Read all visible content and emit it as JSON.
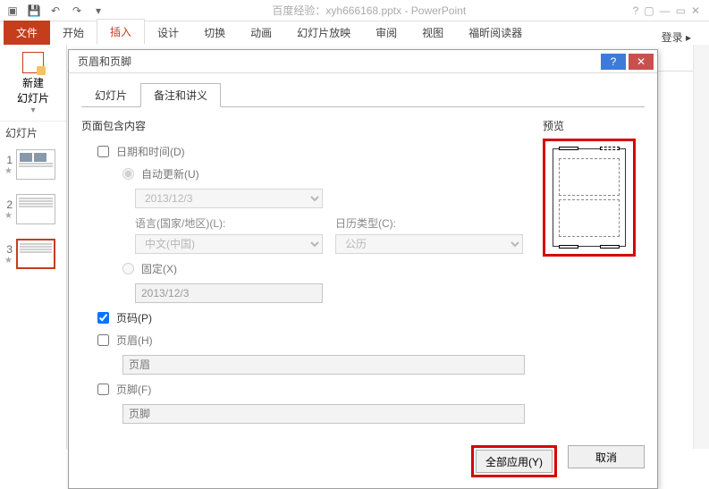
{
  "titlebar": {
    "doc": "百度经验：xyh666168.pptx - PowerPoint"
  },
  "ribbon": {
    "file": "文件",
    "tabs": [
      "开始",
      "插入",
      "设计",
      "切换",
      "动画",
      "幻灯片放映",
      "审阅",
      "视图",
      "福昕阅读器"
    ],
    "active_index": 1,
    "login": "登录"
  },
  "leftpanel": {
    "newslide": "新建\n幻灯片",
    "heading": "幻灯片",
    "thumbs": [
      1,
      2,
      3
    ],
    "selected": 3
  },
  "dialog": {
    "title": "页眉和页脚",
    "tabs": {
      "slide": "幻灯片",
      "notes": "备注和讲义",
      "active": 1
    },
    "section": "页面包含内容",
    "datetime": {
      "chk_label": "日期和时间(D)",
      "checked": false,
      "auto": {
        "label": "自动更新(U)",
        "value": "2013/12/3",
        "lang_label": "语言(国家/地区)(L):",
        "lang_value": "中文(中国)",
        "cal_label": "日历类型(C):",
        "cal_value": "公历"
      },
      "fixed": {
        "label": "固定(X)",
        "value": "2013/12/3"
      }
    },
    "pagenum": {
      "label": "页码(P)",
      "checked": true
    },
    "header": {
      "label": "页眉(H)",
      "checked": false,
      "placeholder": "页眉"
    },
    "footer": {
      "label": "页脚(F)",
      "checked": false,
      "placeholder": "页脚"
    },
    "preview_label": "预览",
    "buttons": {
      "apply_all": "全部应用(Y)",
      "cancel": "取消"
    }
  }
}
